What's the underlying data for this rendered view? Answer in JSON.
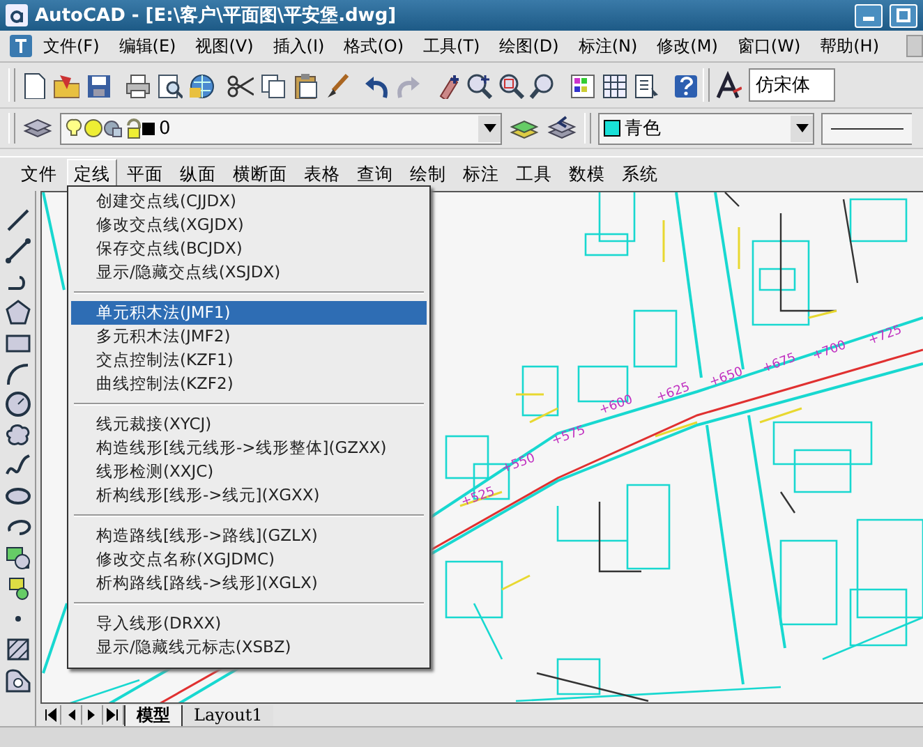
{
  "window": {
    "title": "AutoCAD - [E:\\客户\\平面图\\平安堡.dwg]"
  },
  "menu_bar": {
    "items": [
      {
        "label": "文件(F)"
      },
      {
        "label": "编辑(E)"
      },
      {
        "label": "视图(V)"
      },
      {
        "label": "插入(I)"
      },
      {
        "label": "格式(O)"
      },
      {
        "label": "工具(T)"
      },
      {
        "label": "绘图(D)"
      },
      {
        "label": "标注(N)"
      },
      {
        "label": "修改(M)"
      },
      {
        "label": "窗口(W)"
      },
      {
        "label": "帮助(H)"
      }
    ]
  },
  "standard_toolbar": {
    "font_field": {
      "value": "仿宋体"
    }
  },
  "layer_toolbar": {
    "layer": {
      "value": "0"
    },
    "color": {
      "value": "青色"
    }
  },
  "custom_menu_bar": {
    "items": [
      {
        "label": "文件",
        "selected": false
      },
      {
        "label": "定线",
        "selected": true
      },
      {
        "label": "平面",
        "selected": false
      },
      {
        "label": "纵面",
        "selected": false
      },
      {
        "label": "横断面",
        "selected": false
      },
      {
        "label": "表格",
        "selected": false
      },
      {
        "label": "查询",
        "selected": false
      },
      {
        "label": "绘制",
        "selected": false
      },
      {
        "label": "标注",
        "selected": false
      },
      {
        "label": "工具",
        "selected": false
      },
      {
        "label": "数模",
        "selected": false
      },
      {
        "label": "系统",
        "selected": false
      }
    ]
  },
  "dropdown_menu": {
    "groups": [
      {
        "items": [
          {
            "label": "创建交点线(CJJDX)",
            "selected": false
          },
          {
            "label": "修改交点线(XGJDX)",
            "selected": false
          },
          {
            "label": "保存交点线(BCJDX)",
            "selected": false
          },
          {
            "label": "显示/隐藏交点线(XSJDX)",
            "selected": false
          }
        ]
      },
      {
        "items": [
          {
            "label": "单元积木法(JMF1)",
            "selected": true
          },
          {
            "label": "多元积木法(JMF2)",
            "selected": false
          },
          {
            "label": "交点控制法(KZF1)",
            "selected": false
          },
          {
            "label": "曲线控制法(KZF2)",
            "selected": false
          }
        ]
      },
      {
        "items": [
          {
            "label": "线元裁接(XYCJ)",
            "selected": false
          },
          {
            "label": "构造线形[线元线形->线形整体](GZXX)",
            "selected": false
          },
          {
            "label": "线形检测(XXJC)",
            "selected": false
          },
          {
            "label": "析构线形[线形->线元](XGXX)",
            "selected": false
          }
        ]
      },
      {
        "items": [
          {
            "label": "构造路线[线形->路线](GZLX)",
            "selected": false
          },
          {
            "label": "修改交点名称(XGJDMC)",
            "selected": false
          },
          {
            "label": "析构路线[路线->线形](XGLX)",
            "selected": false
          }
        ]
      },
      {
        "items": [
          {
            "label": "导入线形(DRXX)",
            "selected": false
          },
          {
            "label": "显示/隐藏线元标志(XSBZ)",
            "selected": false
          }
        ]
      }
    ]
  },
  "drawing": {
    "station_labels": [
      {
        "text": "+525"
      },
      {
        "text": "+550"
      },
      {
        "text": "+575"
      },
      {
        "text": "+600"
      },
      {
        "text": "+625"
      },
      {
        "text": "+650"
      },
      {
        "text": "+675"
      },
      {
        "text": "+700"
      },
      {
        "text": "+725"
      }
    ]
  },
  "layout_tabs": [
    {
      "label": "模型",
      "selected": true
    },
    {
      "label": "Layout1",
      "selected": false
    }
  ]
}
